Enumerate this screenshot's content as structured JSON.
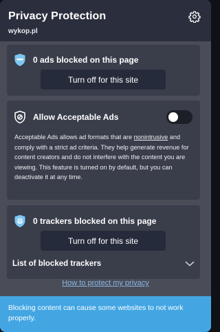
{
  "header": {
    "title": "Privacy Protection",
    "site": "wykop.pl",
    "settings_icon": "gear-icon"
  },
  "ads_card": {
    "icon": "shield-icon",
    "label": "0 ads blocked on this page",
    "button_label": "Turn off for this site"
  },
  "acceptable_ads": {
    "icon": "no-symbol-shield-icon",
    "label": "Allow Acceptable Ads",
    "toggle_on": false,
    "description_before": "Acceptable Ads allows ad formats that are ",
    "description_link": "nonintrusive",
    "description_after": " and comply with a strict ad criteria. They help generate revenue for content creators and do not interfere with the content you are viewing. This feature is turned on by default, but you can deactivate it at any time."
  },
  "trackers_card": {
    "icon": "tracker-shield-icon",
    "label": "0 trackers blocked on this page",
    "button_label": "Turn off for this site",
    "list_label": "List of blocked trackers"
  },
  "help_link": "How to protect my privacy",
  "warning": {
    "text": "Blocking content can cause some websites to not work properly."
  },
  "colors": {
    "header_bg": "#2b2f3d",
    "panel_bg": "#4a4d58",
    "card_bg": "#3a3d4a",
    "button_bg": "#262b3b",
    "accent_blue": "#43a6e3",
    "link_blue": "#8ab6e6",
    "shield_blue": "#7cc6f2"
  }
}
